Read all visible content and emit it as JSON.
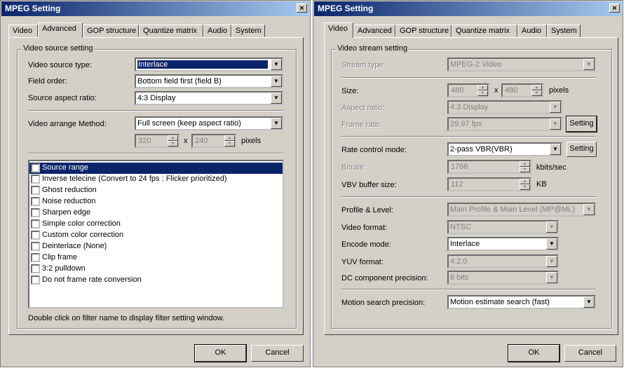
{
  "left": {
    "title": "MPEG Setting",
    "close": "×",
    "tabs": [
      "Video",
      "Advanced",
      "GOP structure",
      "Quantize matrix",
      "Audio",
      "System"
    ],
    "group_label": "Video source setting",
    "source_type": {
      "label": "Video source type:",
      "value": "Interlace"
    },
    "field_order": {
      "label": "Field order:",
      "value": "Bottom field first (field B)"
    },
    "aspect": {
      "label": "Source aspect ratio:",
      "value": "4:3 Display"
    },
    "arrange": {
      "label": "Video arrange Method:",
      "value": "Full screen (keep aspect ratio)"
    },
    "width": "320",
    "x": "x",
    "height": "240",
    "pixels": "pixels",
    "filters": [
      "Source range",
      "Inverse telecine (Convert to 24 fps : Flicker prioritized)",
      "Ghost reduction",
      "Noise reduction",
      "Sharpen edge",
      "Simple color correction",
      "Custom color correction",
      "Deinterlace (None)",
      "Clip frame",
      "3:2 pulldown",
      "Do not frame rate conversion"
    ],
    "hint": "Double click on filter name to display filter setting window.",
    "ok": "OK",
    "cancel": "Cancel"
  },
  "right": {
    "title": "MPEG Setting",
    "close": "×",
    "tabs": [
      "Video",
      "Advanced",
      "GOP structure",
      "Quantize matrix",
      "Audio",
      "System"
    ],
    "group_label": "Video stream setting",
    "stream_type": {
      "label": "Stream type:",
      "value": "MPEG-2 Video"
    },
    "size": {
      "label": "Size:",
      "w": "480",
      "x": "x",
      "h": "480",
      "unit": "pixels"
    },
    "aspect": {
      "label": "Aspect ratio:",
      "value": "4:3 Display"
    },
    "frame_rate": {
      "label": "Frame rate:",
      "value": "29.97 fps",
      "button": "Setting"
    },
    "rate_mode": {
      "label": "Rate control mode:",
      "value": "2-pass VBR(VBR)",
      "button": "Setting"
    },
    "bitrate": {
      "label": "Bitrate:",
      "value": "1766",
      "unit": "kbits/sec"
    },
    "vbv": {
      "label": "VBV buffer size:",
      "value": "112",
      "unit": "KB"
    },
    "profile": {
      "label": "Profile & Level:",
      "value": "Main Profile & Main Level (MP@ML)"
    },
    "video_format": {
      "label": "Video format:",
      "value": "NTSC"
    },
    "encode_mode": {
      "label": "Encode mode:",
      "value": "Interlace"
    },
    "yuv": {
      "label": "YUV format:",
      "value": "4:2:0"
    },
    "dc": {
      "label": "DC component precision:",
      "value": "8 bits"
    },
    "motion": {
      "label": "Motion search precision:",
      "value": "Motion estimate search (fast)"
    },
    "ok": "OK",
    "cancel": "Cancel"
  },
  "colors": {
    "face": "#d4d0c8",
    "title_start": "#0a246a",
    "title_end": "#a6caf0",
    "selection": "#0a246a"
  }
}
